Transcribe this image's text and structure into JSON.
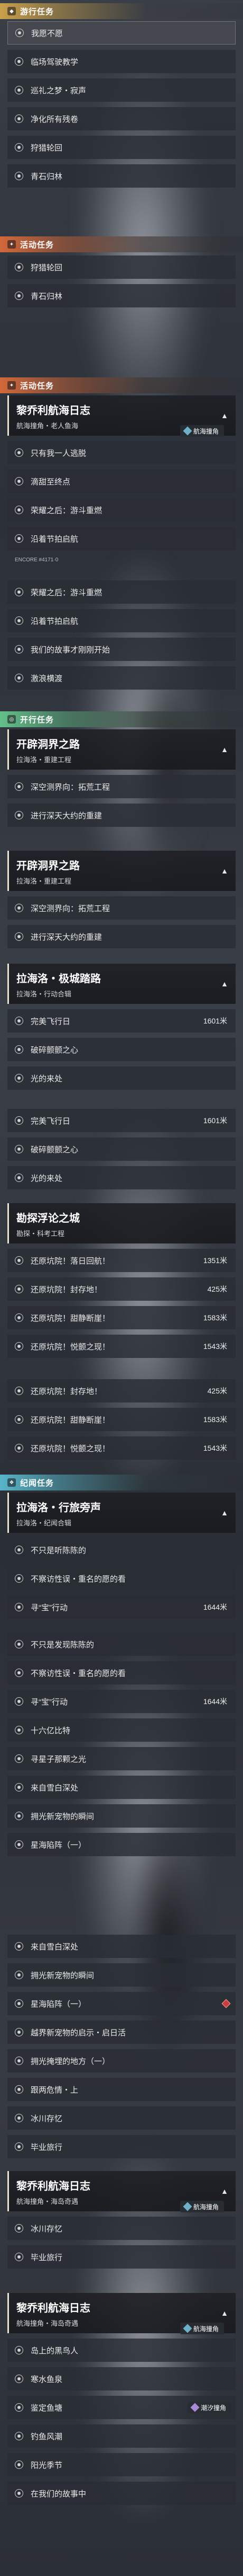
{
  "sections": {
    "daily": {
      "label": "游行任务"
    },
    "event1": {
      "label": "活动任务"
    },
    "event2": {
      "label": "活动任务"
    },
    "trail": {
      "label": "开行任务"
    },
    "legend": {
      "label": "纪闻任务"
    }
  },
  "block1": {
    "rows": [
      {
        "label": "我愿不愿",
        "active": true
      },
      {
        "label": "临场驾驶教学"
      },
      {
        "label": "巡礼之梦・寂声"
      },
      {
        "label": "净化所有残卷"
      },
      {
        "label": "狩猎轮回"
      },
      {
        "label": "青石归林"
      }
    ]
  },
  "block2": {
    "rows": [
      {
        "label": "狩猎轮回"
      },
      {
        "label": "青石归林"
      }
    ]
  },
  "q1": {
    "title": "黎乔利航海日志",
    "subtitle": "航海撞角・老人鱼海",
    "rows": [
      {
        "label": "只有我一人逃脱"
      },
      {
        "label": "滴甜至终点"
      },
      {
        "label": "荣耀之后：游斗重燃"
      },
      {
        "label": "沿着节拍启航"
      }
    ],
    "tag": "航海撞角"
  },
  "q1b": {
    "note": "ENCORE #4171·0",
    "rows": [
      {
        "label": "荣耀之后：游斗重燃"
      },
      {
        "label": "沿着节拍启航"
      },
      {
        "label": "我们的故事才刚刚开始"
      },
      {
        "label": "激浪横渡"
      }
    ]
  },
  "q2": {
    "title": "开辟洞界之路",
    "subtitle": "拉海洛・重建工程",
    "rows": [
      {
        "label": "深空测界向：拓荒工程"
      },
      {
        "label": "进行深天大约的重建"
      }
    ]
  },
  "q2b": {
    "title": "开辟洞界之路",
    "subtitle": "拉海洛・重建工程",
    "rows": [
      {
        "label": "深空测界向：拓荒工程"
      },
      {
        "label": "进行深天大约的重建"
      }
    ]
  },
  "q3": {
    "title": "拉海洛・极城踏路",
    "subtitle": "拉海洛・行动合辑",
    "rows": [
      {
        "label": "完美飞行日",
        "dist": "1601米"
      },
      {
        "label": "破碎颤颤之心"
      },
      {
        "label": "光的来处"
      }
    ]
  },
  "q3b": {
    "rows": [
      {
        "label": "完美飞行日",
        "dist": "1601米"
      },
      {
        "label": "破碎颤颤之心"
      },
      {
        "label": "光的来处"
      }
    ]
  },
  "q4": {
    "title": "勘探浮论之城",
    "subtitle": "勘探・科考工程",
    "rows": [
      {
        "label": "还原坑院！落日回航！",
        "dist": "1351米"
      },
      {
        "label": "还原坑院！封存地！",
        "dist": "425米"
      },
      {
        "label": "还原坑院！甜静断崖！",
        "dist": "1583米"
      },
      {
        "label": "还原坑院！悦颤之现！",
        "dist": "1543米"
      }
    ]
  },
  "q4b": {
    "rows": [
      {
        "label": "还原坑院！封存地！",
        "dist": "425米"
      },
      {
        "label": "还原坑院！甜静断崖！",
        "dist": "1583米"
      },
      {
        "label": "还原坑院！悦颤之现！",
        "dist": "1543米"
      }
    ]
  },
  "q5": {
    "title": "拉海洛・行旅旁声",
    "subtitle": "拉海洛・纪闻合辑",
    "rows": [
      {
        "label": "不只是听陈陈的"
      },
      {
        "label": "不察访性误・重名的愿的看"
      },
      {
        "label": "寻“宝”行动",
        "dist": "1644米"
      },
      {
        "label": "不只是发现陈陈的"
      },
      {
        "label": "不察访性误・重名的愿的看"
      },
      {
        "label": "寻“宝”行动",
        "dist": "1644米"
      },
      {
        "label": "十六亿比特"
      },
      {
        "label": "寻星子那颗之光"
      },
      {
        "label": "来自雪白深处"
      },
      {
        "label": "拥光新宠物的瞬间"
      },
      {
        "label": "星海陷阵（一）"
      }
    ]
  },
  "q5b": {
    "rows": [
      {
        "label": "来自雪白深处"
      },
      {
        "label": "拥光新宠物的瞬间"
      },
      {
        "label": "星海陷阵（一）"
      },
      {
        "label": "越界新宠物的启示・启日活"
      },
      {
        "label": "拥光掩埋的地方（一）"
      },
      {
        "label": "跟两危情・上"
      },
      {
        "label": "冰川存忆"
      },
      {
        "label": "毕业旅行"
      }
    ]
  },
  "q6": {
    "title": "黎乔利航海日志",
    "subtitle": "航海撞角・海岛奇遇",
    "rows": [
      {
        "label": "冰川存忆"
      },
      {
        "label": "毕业旅行"
      }
    ],
    "tag": "航海撞角"
  },
  "q6b": {
    "title": "黎乔利航海日志",
    "subtitle": "航海撞角・海岛奇遇",
    "rows": [
      {
        "label": "岛上的黑鸟人"
      },
      {
        "label": "寒水鱼泉"
      },
      {
        "label": "鉴定鱼塘"
      },
      {
        "label": "钓鱼风潮"
      },
      {
        "label": "阳光季节"
      },
      {
        "label": "在我们的故事中"
      }
    ],
    "tag": "航海撞角",
    "tag2": "潮汐撞角"
  }
}
